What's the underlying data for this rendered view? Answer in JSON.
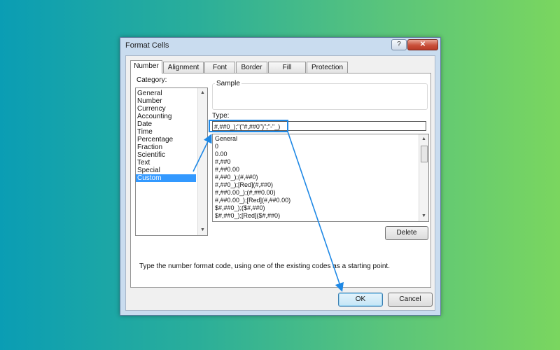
{
  "dialog": {
    "title": "Format Cells",
    "help_label": "?",
    "close_label": "✕"
  },
  "tabs": [
    "Number",
    "Alignment",
    "Font",
    "Border",
    "Fill",
    "Protection"
  ],
  "number": {
    "category_label": "Category:",
    "categories": [
      "General",
      "Number",
      "Currency",
      "Accounting",
      "Date",
      "Time",
      "Percentage",
      "Fraction",
      "Scientific",
      "Text",
      "Special",
      "Custom"
    ],
    "selected_category": "Custom",
    "sample_label": "Sample",
    "type_label": "Type:",
    "type_value": "#,##0_);\"(\"#,##0\")\";\"-\"_)",
    "formats": [
      "General",
      "0",
      "0.00",
      "#,##0",
      "#,##0.00",
      "#,##0_);(#,##0)",
      "#,##0_);[Red](#,##0)",
      "#,##0.00_);(#,##0.00)",
      "#,##0.00_);[Red](#,##0.00)",
      "$#,##0_);($#,##0)",
      "$#,##0_);[Red]($#,##0)"
    ],
    "delete_label": "Delete",
    "description": "Type the number format code, using one of the existing codes as a starting point."
  },
  "buttons": {
    "ok": "OK",
    "cancel": "Cancel"
  },
  "colors": {
    "accent": "#1e88e5",
    "selection": "#3399ff"
  }
}
